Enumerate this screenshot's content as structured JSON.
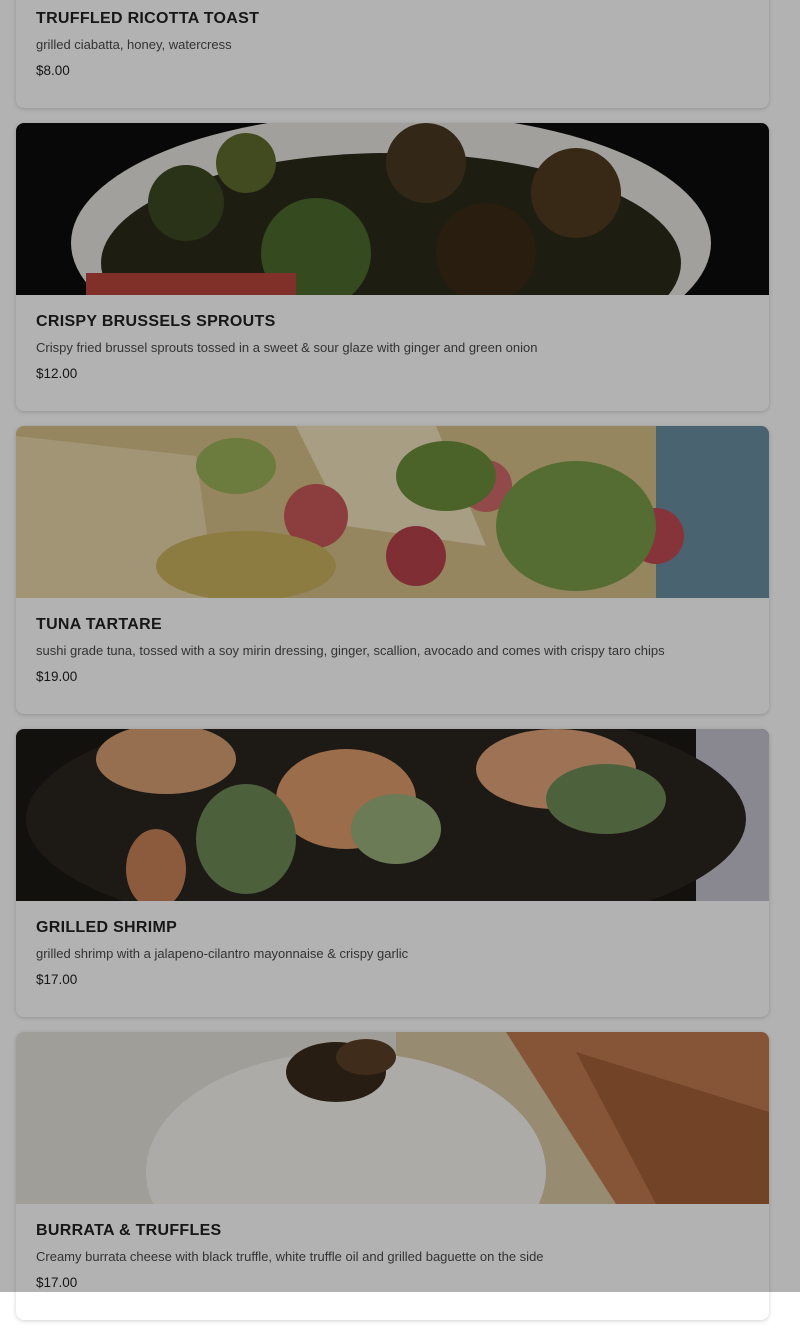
{
  "menu_items": [
    {
      "name": "TRUFFLED RICOTTA TOAST",
      "description": "grilled ciabatta, honey, watercress",
      "price": "$8.00",
      "image_icon": "toast-photo"
    },
    {
      "name": "CRISPY BRUSSELS SPROUTS",
      "description": "Crispy fried brussel sprouts tossed in a sweet & sour glaze with ginger and green onion",
      "price": "$12.00",
      "image_icon": "brussels-sprouts-photo"
    },
    {
      "name": "TUNA TARTARE",
      "description": "sushi grade tuna, tossed with a soy mirin dressing, ginger, scallion, avocado and comes with crispy taro chips",
      "price": "$19.00",
      "image_icon": "tuna-tartare-photo"
    },
    {
      "name": "GRILLED SHRIMP",
      "description": "grilled shrimp with a jalapeno-cilantro mayonnaise & crispy garlic",
      "price": "$17.00",
      "image_icon": "grilled-shrimp-photo"
    },
    {
      "name": "BURRATA & TRUFFLES",
      "description": "Creamy burrata cheese with black truffle, white truffle oil and grilled baguette on the side",
      "price": "$17.00",
      "image_icon": "burrata-photo"
    }
  ],
  "colors": {
    "overlay": "rgba(0,0,0,0.30)",
    "card": "#ffffff",
    "text": "#222222"
  }
}
